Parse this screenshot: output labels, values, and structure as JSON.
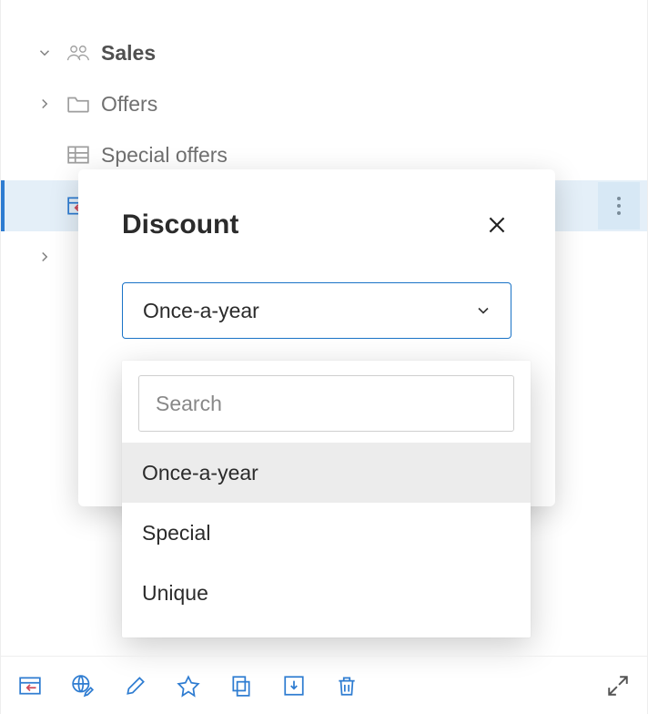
{
  "tree": {
    "items": [
      {
        "label": "Sales",
        "expander": "down",
        "icon": "people",
        "bold": true
      },
      {
        "label": "Offers",
        "expander": "right",
        "icon": "folder"
      },
      {
        "label": "Special offers",
        "expander": "",
        "icon": "table"
      },
      {
        "label": "",
        "expander": "",
        "icon": "page-in",
        "selected": true
      },
      {
        "label": "",
        "expander": "right",
        "icon": ""
      }
    ]
  },
  "modal": {
    "title": "Discount",
    "select_value": "Once-a-year",
    "search_placeholder": "Search",
    "options": [
      "Once-a-year",
      "Special",
      "Unique"
    ],
    "selected_option": "Once-a-year"
  },
  "colors": {
    "accent": "#2e7cd1"
  }
}
